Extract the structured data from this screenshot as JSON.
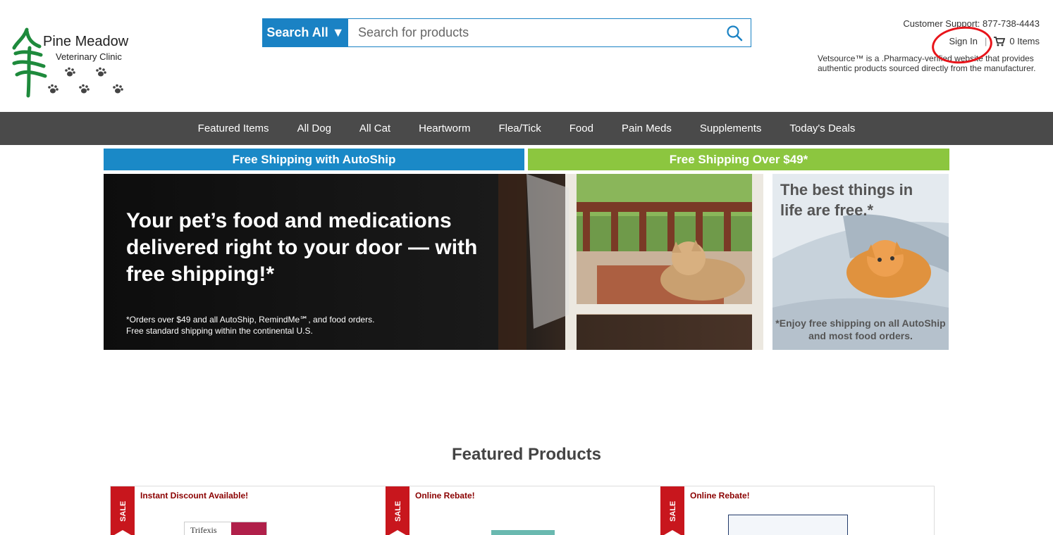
{
  "brand": {
    "name_line1": "Pine Meadow",
    "name_line2": "Veterinary Clinic",
    "tree_color": "#1e8a3c"
  },
  "search": {
    "scope_label": "Search All",
    "placeholder": "Search for products"
  },
  "header": {
    "support": "Customer Support: 877-738-4443",
    "sign_in": "Sign In",
    "separator": "|",
    "cart_label": "0 Items",
    "vet_note": "Vetsource™ is a .Pharmacy-verified website that provides authentic products sourced directly from the manufacturer."
  },
  "nav": {
    "items": [
      "Featured Items",
      "All Dog",
      "All Cat",
      "Heartworm",
      "Flea/Tick",
      "Food",
      "Pain Meds",
      "Supplements",
      "Today's Deals"
    ]
  },
  "shipping": {
    "autoship": "Free Shipping with AutoShip",
    "over49": "Free Shipping Over $49*"
  },
  "hero": {
    "headline": "Your pet’s food and medications delivered right to your door — with free shipping!*",
    "fine_line1": "*Orders over $49 and all AutoShip, RemindMe℠, and food orders.",
    "fine_line2": "Free standard shipping within the continental U.S."
  },
  "promo": {
    "headline": "The best things in life are free.*",
    "footnote": "*Enjoy free shipping on all AutoShip and most food orders."
  },
  "featured": {
    "title": "Featured Products",
    "sale_label": "SALE",
    "cards": [
      {
        "tag": "Instant Discount Available!",
        "product": "Trifexis"
      },
      {
        "tag": "Online Rebate!"
      },
      {
        "tag": "Online Rebate!"
      }
    ]
  },
  "colors": {
    "accent_blue": "#1a82c4",
    "accent_green": "#8cc63f",
    "nav_bg": "#4a4a4a",
    "annotation_red": "#e8141a"
  }
}
